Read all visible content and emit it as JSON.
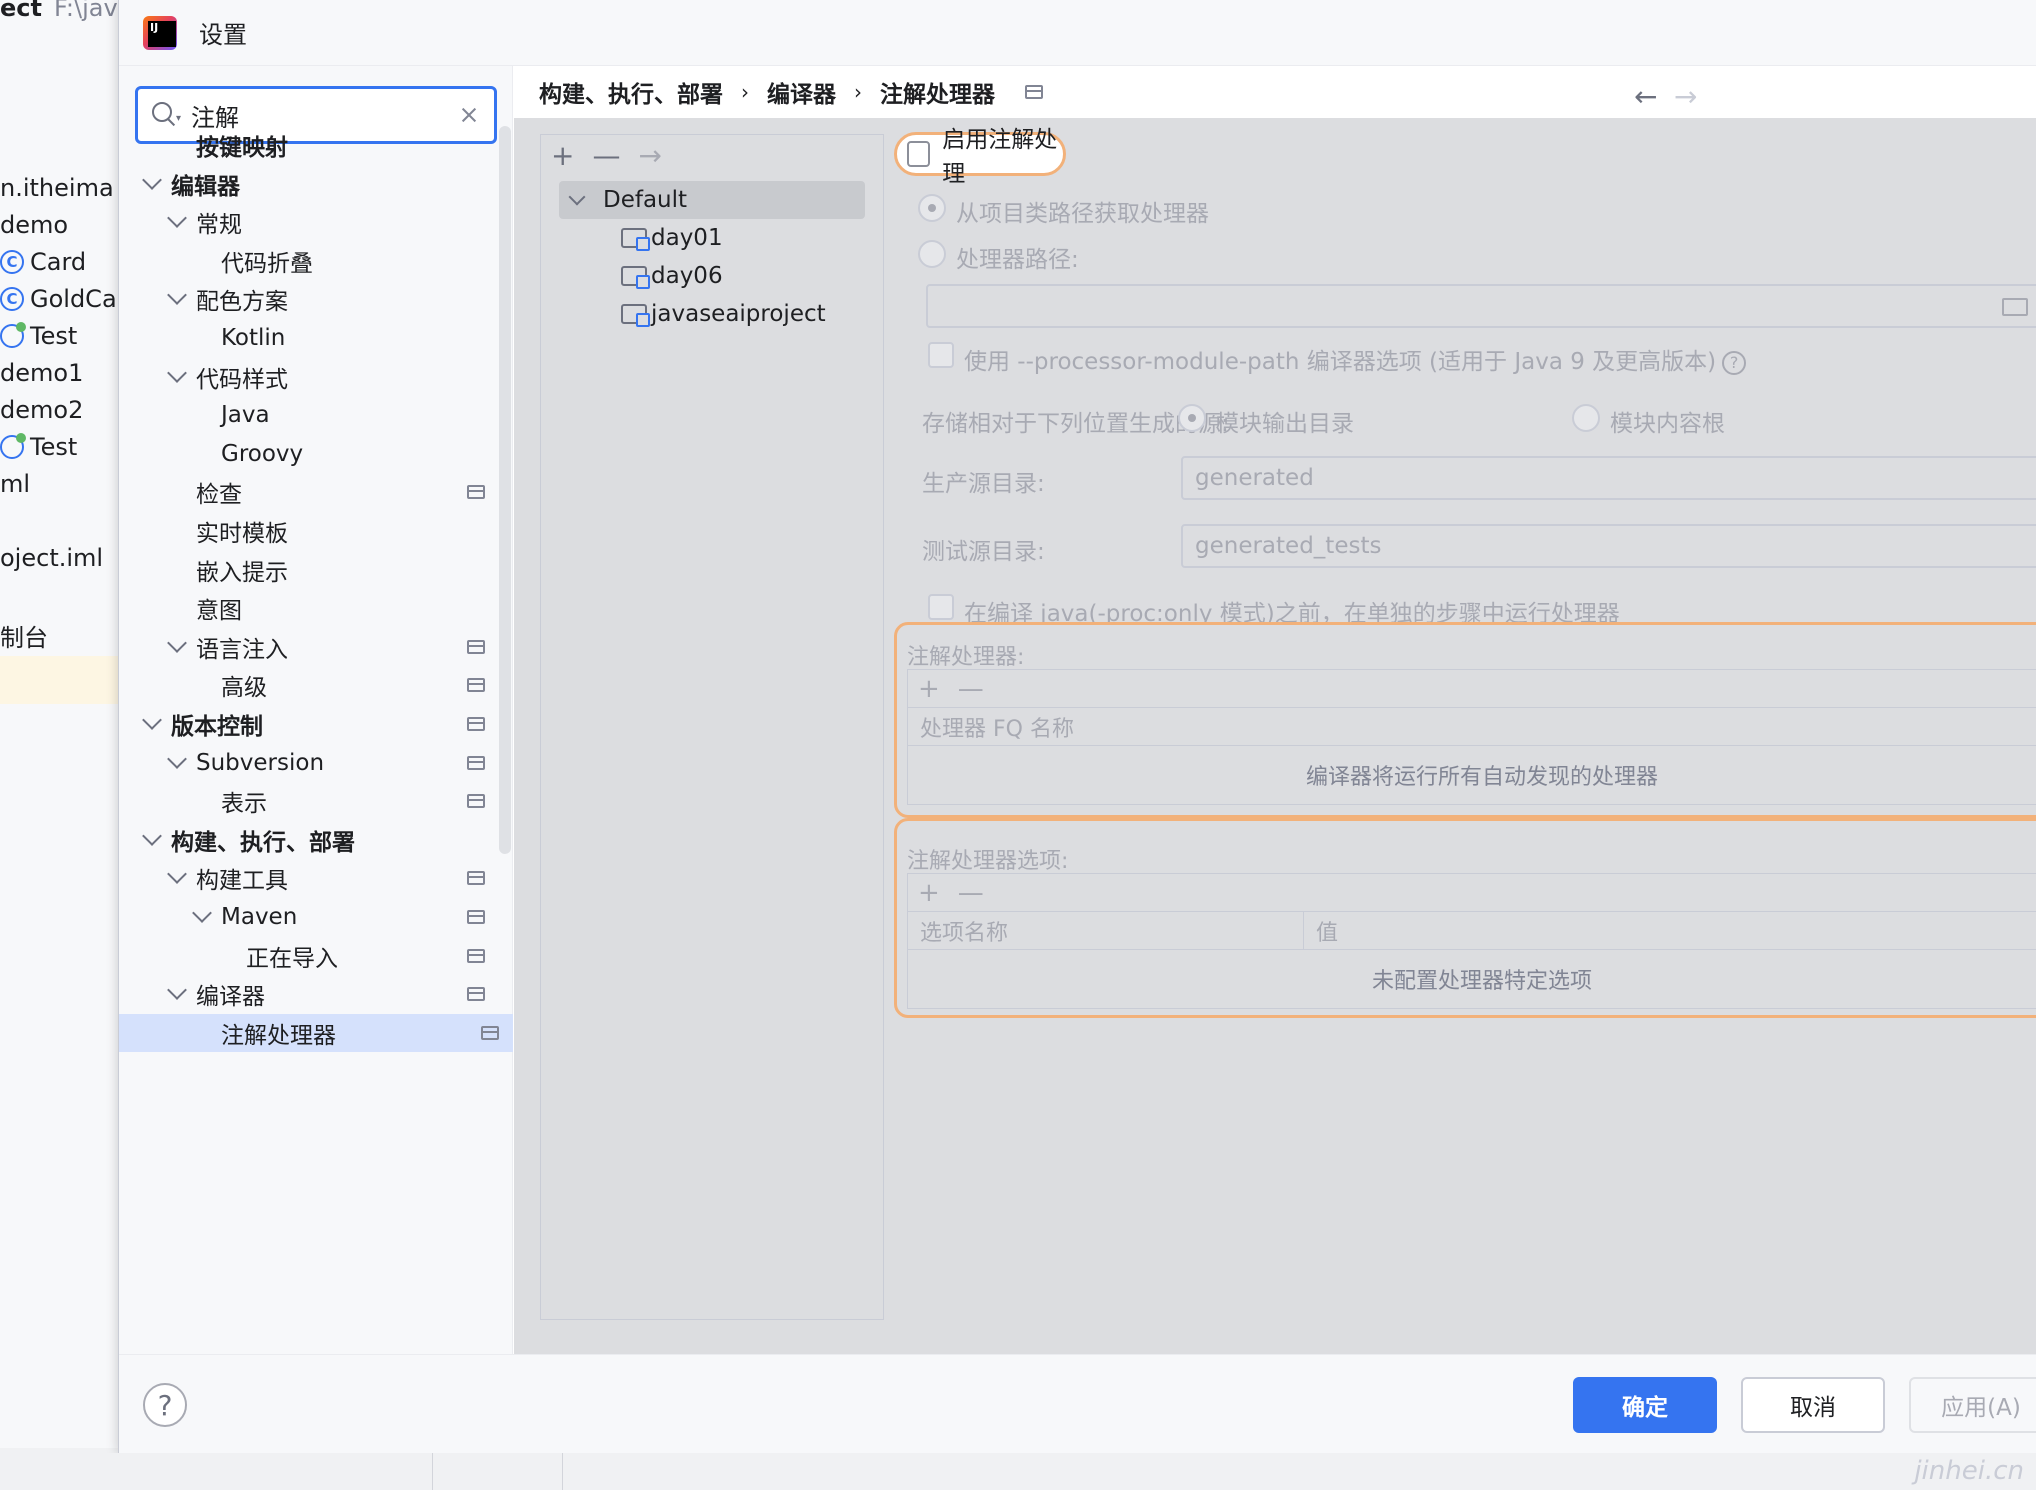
{
  "ide": {
    "title": "ect",
    "path": "F:\\java\\",
    "rows": [
      {
        "text": "n.itheima",
        "icon": "none"
      },
      {
        "text": "demo",
        "icon": "none"
      },
      {
        "text": "Card",
        "icon": "class-icon"
      },
      {
        "text": "GoldCa",
        "icon": "class-icon"
      },
      {
        "text": "Test",
        "icon": "test-icon"
      },
      {
        "text": "demo1",
        "icon": "none"
      },
      {
        "text": "demo2",
        "icon": "none"
      },
      {
        "text": "Test",
        "icon": "test-icon"
      },
      {
        "text": "ml",
        "icon": "none"
      },
      {
        "text": "",
        "icon": "none"
      },
      {
        "text": "oject.iml",
        "icon": "none"
      },
      {
        "text": "制台",
        "icon": "none"
      }
    ]
  },
  "dialog": {
    "title": "设置"
  },
  "search": {
    "value": "注解"
  },
  "tree": [
    {
      "label": "按键映射",
      "level": 1,
      "bold": true,
      "chevron": false,
      "proj": false
    },
    {
      "label": "编辑器",
      "level": 0,
      "bold": true,
      "chevron": true,
      "proj": false
    },
    {
      "label": "常规",
      "level": 1,
      "bold": false,
      "chevron": true,
      "proj": false
    },
    {
      "label": "代码折叠",
      "level": 2,
      "bold": false,
      "chevron": false,
      "proj": false
    },
    {
      "label": "配色方案",
      "level": 1,
      "bold": false,
      "chevron": true,
      "proj": false
    },
    {
      "label": "Kotlin",
      "level": 2,
      "bold": false,
      "chevron": false,
      "proj": false
    },
    {
      "label": "代码样式",
      "level": 1,
      "bold": false,
      "chevron": true,
      "proj": false
    },
    {
      "label": "Java",
      "level": 2,
      "bold": false,
      "chevron": false,
      "proj": false
    },
    {
      "label": "Groovy",
      "level": 2,
      "bold": false,
      "chevron": false,
      "proj": false
    },
    {
      "label": "检查",
      "level": 1.5,
      "bold": false,
      "chevron": false,
      "proj": true
    },
    {
      "label": "实时模板",
      "level": 1.5,
      "bold": false,
      "chevron": false,
      "proj": false
    },
    {
      "label": "嵌入提示",
      "level": 1.5,
      "bold": false,
      "chevron": false,
      "proj": false
    },
    {
      "label": "意图",
      "level": 1.5,
      "bold": false,
      "chevron": false,
      "proj": false
    },
    {
      "label": "语言注入",
      "level": 1,
      "bold": false,
      "chevron": true,
      "proj": true
    },
    {
      "label": "高级",
      "level": 2,
      "bold": false,
      "chevron": false,
      "proj": true
    },
    {
      "label": "版本控制",
      "level": 0,
      "bold": true,
      "chevron": true,
      "proj": true
    },
    {
      "label": "Subversion",
      "level": 1,
      "bold": false,
      "chevron": true,
      "proj": true
    },
    {
      "label": "表示",
      "level": 2,
      "bold": false,
      "chevron": false,
      "proj": true
    },
    {
      "label": "构建、执行、部署",
      "level": 0,
      "bold": true,
      "chevron": true,
      "proj": false
    },
    {
      "label": "构建工具",
      "level": 1,
      "bold": false,
      "chevron": true,
      "proj": true
    },
    {
      "label": "Maven",
      "level": 2,
      "bold": false,
      "chevron": true,
      "proj": true
    },
    {
      "label": "正在导入",
      "level": 3,
      "bold": false,
      "chevron": false,
      "proj": true
    },
    {
      "label": "编译器",
      "level": 1,
      "bold": false,
      "chevron": true,
      "proj": true
    },
    {
      "label": "注解处理器",
      "level": 2,
      "bold": false,
      "chevron": false,
      "proj": true,
      "selected": true
    }
  ],
  "breadcrumb": [
    "构建、执行、部署",
    "编译器",
    "注解处理器"
  ],
  "breadcrumb_sep": "›",
  "profiles": {
    "toolbar": [
      "+",
      "—",
      "→"
    ],
    "default_label": "Default",
    "modules": [
      "day01",
      "day06",
      "javaseaiproject"
    ]
  },
  "settings": {
    "enable_label": "启用注解处理",
    "from_classpath": "从项目类路径获取处理器",
    "processor_path": "处理器路径:",
    "module_path_option": "使用 --processor-module-path 编译器选项 (适用于 Java 9 及更高版本)",
    "store_relative": "存储相对于下列位置生成的源:",
    "module_output": "模块输出目录",
    "module_content": "模块内容根",
    "prod_source_label": "生产源目录:",
    "prod_source_value": "generated",
    "test_source_label": "测试源目录:",
    "test_source_value": "generated_tests",
    "run_separately": "在编译 java(-proc:only 模式)之前，在单独的步骤中运行处理器",
    "processors_title": "注解处理器:",
    "processors_col": "处理器 FQ 名称",
    "processors_empty": "编译器将运行所有自动发现的处理器",
    "options_title": "注解处理器选项:",
    "options_col_name": "选项名称",
    "options_col_value": "值",
    "options_empty": "未配置处理器特定选项",
    "toolbar_add": "+",
    "toolbar_remove": "—"
  },
  "footer": {
    "help": "?",
    "ok": "确定",
    "cancel": "取消",
    "apply": "应用(A)"
  },
  "watermark": "jinhei.cn"
}
